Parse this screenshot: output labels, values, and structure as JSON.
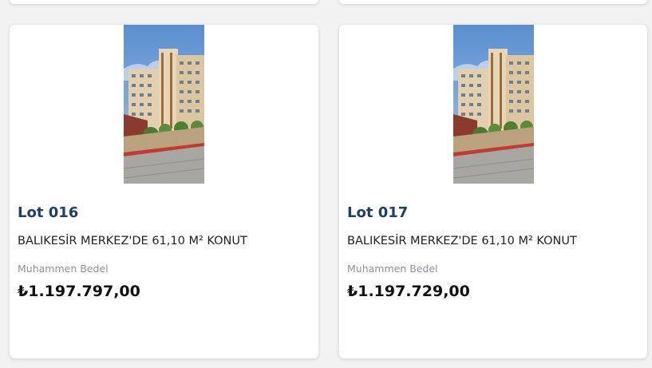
{
  "lots": [
    {
      "lot_number": "Lot 016",
      "description": "BALIKESİR MERKEZ'DE 61,10 M² KONUT",
      "price_label": "Muhammen Bedel",
      "price": "₺1.197.797,00"
    },
    {
      "lot_number": "Lot 017",
      "description": "BALIKESİR MERKEZ'DE 61,10 M² KONUT",
      "price_label": "Muhammen Bedel",
      "price": "₺1.197.729,00"
    }
  ],
  "colors": {
    "lot_title": "#1f3d6e",
    "page_background": "#f2f2f2",
    "card_background": "#ffffff"
  }
}
